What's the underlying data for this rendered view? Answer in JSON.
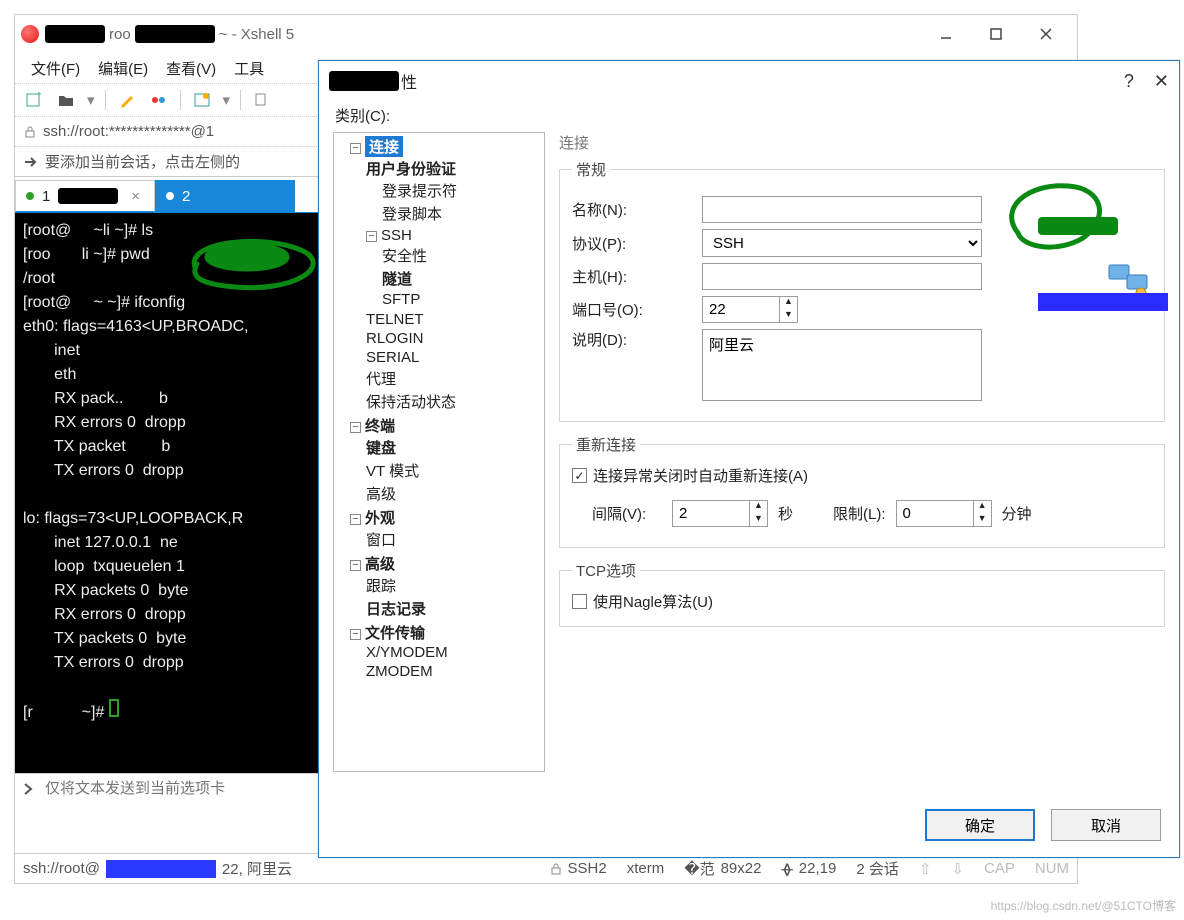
{
  "app": {
    "title_fragment_a": "roo",
    "title_suffix": "~ - Xshell 5"
  },
  "menu": {
    "file": "文件(F)",
    "edit": "编辑(E)",
    "view": "查看(V)",
    "tools": "工具"
  },
  "address": {
    "text": "ssh://root:**************@1"
  },
  "hint": {
    "text": "要添加当前会话，点击左侧的"
  },
  "tabs": {
    "t1_num": "1",
    "t2_num": "2"
  },
  "terminal": {
    "lines": "[root@     ~li ~]# ls\n[roo       li ~]# pwd\n/root\n[root@     ~ ~]# ifconfig\neth0: flags=4163<UP,BROADC,\n       inet \n       eth\n       RX pack..        b\n       RX errors 0  dropp\n       TX packet        b\n       TX errors 0  dropp\n\nlo: flags=73<UP,LOOPBACK,R\n       inet 127.0.0.1  ne\n       loop  txqueuelen 1\n       RX packets 0  byte\n       RX errors 0  dropp\n       TX packets 0  byte\n       TX errors 0  dropp\n\n[r           ~]# "
  },
  "sendbar": {
    "placeholder": "仅将文本发送到当前选项卡"
  },
  "status": {
    "left_prefix": "ssh://root@",
    "left_suffix": "22, 阿里云",
    "ssh": "SSH2",
    "term": "xterm",
    "size": "89x22",
    "pos": "22,19",
    "sessions": "2 会话",
    "cap": "CAP",
    "num": "NUM"
  },
  "dialog": {
    "title_suffix": "性",
    "category_label": "类别(C):",
    "tree": {
      "connection": "连接",
      "auth": "用户身份验证",
      "login_prompt": "登录提示符",
      "login_script": "登录脚本",
      "ssh": "SSH",
      "security": "安全性",
      "tunnel": "隧道",
      "sftp": "SFTP",
      "telnet": "TELNET",
      "rlogin": "RLOGIN",
      "serial": "SERIAL",
      "proxy": "代理",
      "keepalive": "保持活动状态",
      "terminal": "终端",
      "keyboard": "键盘",
      "vt": "VT 模式",
      "advanced_term": "高级",
      "appearance": "外观",
      "window": "窗口",
      "advanced": "高级",
      "trace": "跟踪",
      "log": "日志记录",
      "file_transfer": "文件传输",
      "xymodem": "X/YMODEM",
      "zmodem": "ZMODEM"
    },
    "section_connection": "连接",
    "general": {
      "legend": "常规",
      "name_label": "名称(N):",
      "protocol_label": "协议(P):",
      "protocol_value": "SSH",
      "host_label": "主机(H):",
      "port_label": "端口号(O):",
      "port_value": "22",
      "desc_label": "说明(D):",
      "desc_value": "阿里云"
    },
    "reconnect": {
      "legend": "重新连接",
      "auto_label": "连接异常关闭时自动重新连接(A)",
      "auto_checked": true,
      "interval_label": "间隔(V):",
      "interval_value": "2",
      "interval_unit": "秒",
      "limit_label": "限制(L):",
      "limit_value": "0",
      "limit_unit": "分钟"
    },
    "tcp": {
      "legend": "TCP选项",
      "nagle_label": "使用Nagle算法(U)",
      "nagle_checked": false
    },
    "buttons": {
      "ok": "确定",
      "cancel": "取消"
    }
  },
  "watermark": "https://blog.csdn.net/@51CTO博客"
}
